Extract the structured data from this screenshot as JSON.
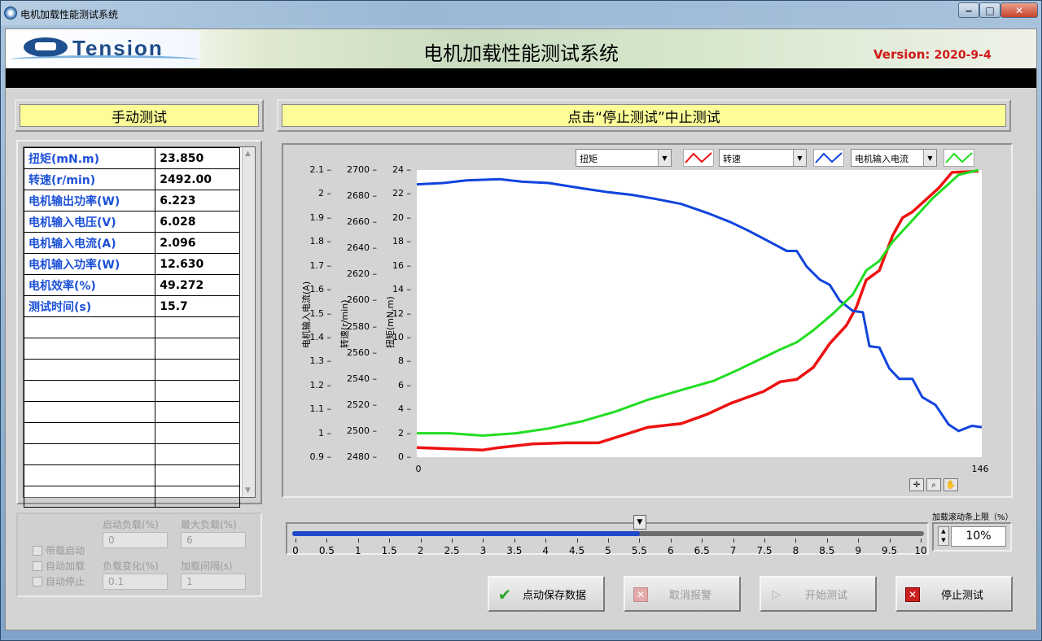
{
  "window": {
    "title": "电机加载性能测试系统"
  },
  "window_controls": {
    "minimize": "‒",
    "maximize": "□",
    "close": "✕"
  },
  "header": {
    "logo_text": "Tension",
    "app_title": "电机加载性能测试系统",
    "version_label": "Version:",
    "version_value": "2020-9-4"
  },
  "left_panel": {
    "title": "手动测试",
    "rows": [
      {
        "label": "扭矩(mN.m)",
        "value": "23.850"
      },
      {
        "label": "转速(r/min)",
        "value": "2492.00"
      },
      {
        "label": "电机输出功率(W)",
        "value": "6.223"
      },
      {
        "label": "电机输入电压(V)",
        "value": "6.028"
      },
      {
        "label": "电机输入电流(A)",
        "value": "2.096"
      },
      {
        "label": "电机输入功率(W)",
        "value": "12.630"
      },
      {
        "label": "电机效率(%)",
        "value": "49.272"
      },
      {
        "label": "测试时间(s)",
        "value": "15.7"
      }
    ],
    "empty_rows": 9
  },
  "settings": {
    "chk_start_load": "带载启动",
    "chk_auto_load": "自动加载",
    "chk_auto_stop": "自动停止",
    "start_load_label": "启动负载(%)",
    "start_load_value": "0",
    "max_load_label": "最大负载(%)",
    "max_load_value": "6",
    "load_change_label": "负载变化(%)",
    "load_change_value": "0.1",
    "load_interval_label": "加载间隔(s)",
    "load_interval_value": "1"
  },
  "chart_header": {
    "title": "点击“停止测试”中止测试"
  },
  "legend": {
    "sel1": "扭矩",
    "sel2": "转速",
    "sel3": "电机输入电流",
    "color1": "#ee1111",
    "color2": "#1144dd",
    "color3": "#22dd22"
  },
  "chart_data": {
    "type": "line",
    "x_range": [
      0,
      146
    ],
    "x_ticks": [
      "0",
      "146"
    ],
    "axes": [
      {
        "title": "电机输入电流(A)",
        "range": [
          0.9,
          2.1
        ],
        "ticks": [
          "0.9",
          "1",
          "1.1",
          "1.2",
          "1.3",
          "1.4",
          "1.5",
          "1.6",
          "1.7",
          "1.8",
          "1.9",
          "2",
          "2.1"
        ]
      },
      {
        "title": "转速(r/min)",
        "range": [
          2480,
          2700
        ],
        "ticks": [
          "2480",
          "2500",
          "2520",
          "2540",
          "2560",
          "2580",
          "2600",
          "2620",
          "2640",
          "2660",
          "2680",
          "2700"
        ]
      },
      {
        "title": "扭矩(mN.m)",
        "range": [
          0,
          24
        ],
        "ticks": [
          "0",
          "2",
          "4",
          "6",
          "8",
          "10",
          "12",
          "14",
          "16",
          "18",
          "20",
          "22",
          "24"
        ]
      }
    ],
    "series": [
      {
        "name": "扭矩",
        "color": "#ee1111",
        "axis": 2,
        "points": [
          [
            0,
            0.8
          ],
          [
            10,
            0.7
          ],
          [
            20,
            0.6
          ],
          [
            25,
            0.8
          ],
          [
            35,
            1.1
          ],
          [
            45,
            1.2
          ],
          [
            55,
            1.2
          ],
          [
            62,
            1.8
          ],
          [
            70,
            2.5
          ],
          [
            80,
            2.8
          ],
          [
            88,
            3.6
          ],
          [
            95,
            4.5
          ],
          [
            100,
            5.0
          ],
          [
            105,
            5.5
          ],
          [
            110,
            6.3
          ],
          [
            115,
            6.5
          ],
          [
            120,
            7.5
          ],
          [
            125,
            9.5
          ],
          [
            130,
            11.0
          ],
          [
            133,
            12.5
          ],
          [
            136,
            14.8
          ],
          [
            140,
            15.6
          ],
          [
            144,
            18.5
          ],
          [
            147,
            20.0
          ],
          [
            150,
            20.5
          ],
          [
            154,
            21.5
          ],
          [
            158,
            22.5
          ],
          [
            162,
            23.8
          ],
          [
            170,
            23.9
          ]
        ]
      },
      {
        "name": "转速",
        "color": "#1144dd",
        "axis": 1,
        "points": [
          [
            0,
            2689
          ],
          [
            8,
            2690
          ],
          [
            15,
            2692
          ],
          [
            25,
            2693
          ],
          [
            32,
            2691
          ],
          [
            40,
            2690
          ],
          [
            50,
            2686
          ],
          [
            58,
            2683
          ],
          [
            65,
            2681
          ],
          [
            72,
            2678
          ],
          [
            80,
            2674
          ],
          [
            88,
            2667
          ],
          [
            95,
            2660
          ],
          [
            100,
            2654
          ],
          [
            106,
            2646
          ],
          [
            112,
            2638
          ],
          [
            115,
            2638
          ],
          [
            118,
            2626
          ],
          [
            122,
            2616
          ],
          [
            125,
            2612
          ],
          [
            128,
            2600
          ],
          [
            132,
            2592
          ],
          [
            135,
            2591
          ],
          [
            137,
            2565
          ],
          [
            140,
            2564
          ],
          [
            143,
            2548
          ],
          [
            146,
            2540
          ],
          [
            150,
            2540
          ],
          [
            153,
            2526
          ],
          [
            157,
            2520
          ],
          [
            161,
            2505
          ],
          [
            164,
            2500
          ],
          [
            168,
            2504
          ],
          [
            171,
            2503
          ]
        ]
      },
      {
        "name": "电机输入电流",
        "color": "#22dd22",
        "axis": 0,
        "points": [
          [
            0,
            1.0
          ],
          [
            10,
            1.0
          ],
          [
            20,
            0.99
          ],
          [
            30,
            1.0
          ],
          [
            40,
            1.02
          ],
          [
            50,
            1.05
          ],
          [
            60,
            1.09
          ],
          [
            70,
            1.14
          ],
          [
            80,
            1.18
          ],
          [
            90,
            1.22
          ],
          [
            98,
            1.27
          ],
          [
            104,
            1.31
          ],
          [
            110,
            1.35
          ],
          [
            115,
            1.38
          ],
          [
            120,
            1.43
          ],
          [
            126,
            1.5
          ],
          [
            132,
            1.58
          ],
          [
            136,
            1.68
          ],
          [
            140,
            1.72
          ],
          [
            144,
            1.8
          ],
          [
            148,
            1.86
          ],
          [
            152,
            1.92
          ],
          [
            156,
            1.98
          ],
          [
            160,
            2.03
          ],
          [
            164,
            2.08
          ],
          [
            170,
            2.1
          ]
        ]
      }
    ]
  },
  "slider": {
    "label": "加载滚动条上限（%）",
    "value": 5.5,
    "max": 10,
    "ticks": [
      "0",
      "0.5",
      "1",
      "1.5",
      "2",
      "2.5",
      "3",
      "3.5",
      "4",
      "4.5",
      "5",
      "5.5",
      "6",
      "6.5",
      "7",
      "7.5",
      "8",
      "8.5",
      "9",
      "9.5",
      "10"
    ],
    "pct_value": "10%"
  },
  "buttons": {
    "save": "点动保存数据",
    "cancel_alarm": "取消报警",
    "start": "开始测试",
    "stop": "停止测试"
  },
  "icons": {
    "save": "check-icon",
    "cancel_alarm": "x-icon",
    "start": "play-icon",
    "stop": "x-icon"
  }
}
